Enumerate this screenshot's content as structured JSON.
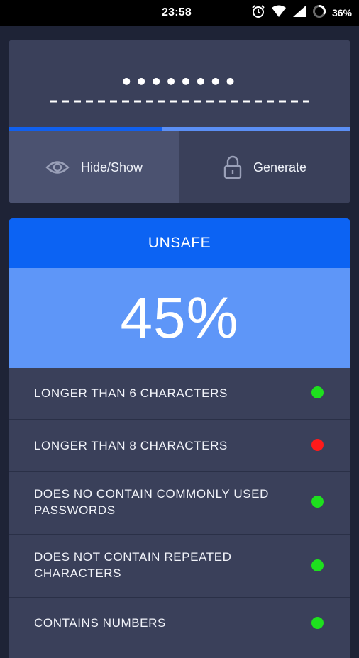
{
  "status_bar": {
    "time": "23:58",
    "battery": "36%"
  },
  "password": {
    "masked_value": "••••••••",
    "underline": "- - - - - - - - - - - - - - - - - - - - -",
    "strength_progress": 0.45
  },
  "actions": {
    "hide_show_label": "Hide/Show",
    "generate_label": "Generate"
  },
  "strength": {
    "verdict": "UNSAFE",
    "score": "45%"
  },
  "rules": [
    {
      "label": "LONGER THAN 6 CHARACTERS",
      "passed": true
    },
    {
      "label": "LONGER THAN 8 CHARACTERS",
      "passed": false
    },
    {
      "label": "DOES NO CONTAIN COMMONLY USED PASSWORDS",
      "passed": true
    },
    {
      "label": "DOES NOT CONTAIN REPEATED CHARACTERS",
      "passed": true
    },
    {
      "label": "CONTAINS NUMBERS",
      "passed": true
    }
  ],
  "colors": {
    "pass": "#1ee01e",
    "fail": "#ff1a1a",
    "accent": "#0c63f3",
    "accent_light": "#5e96f8"
  }
}
